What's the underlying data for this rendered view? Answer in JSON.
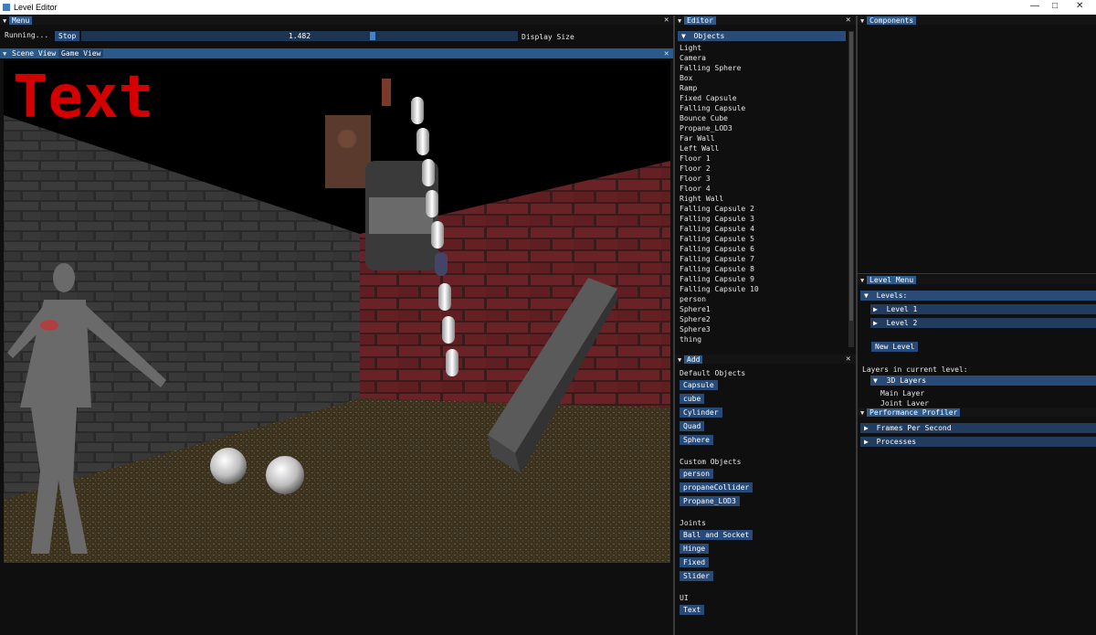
{
  "window": {
    "title": "Level Editor",
    "controls": [
      "—",
      "□",
      "✕"
    ]
  },
  "menu_panel": {
    "tab": "Menu",
    "status": "Running...",
    "stop_label": "Stop",
    "display_size_value": "1.482",
    "display_size_label": "Display Size",
    "slider_fraction": 0.67
  },
  "viewport": {
    "tabs": [
      "Scene View",
      "Game View"
    ],
    "overlay_text": "Text",
    "text_color": "#d40000"
  },
  "editor": {
    "tab": "Editor",
    "header": "Objects",
    "objects": [
      "Light",
      "Camera",
      "Falling Sphere",
      "Box",
      "Ramp",
      "Fixed Capsule",
      "Falling Capsule",
      "Bounce Cube",
      "Propane_LOD3",
      "Far Wall",
      "Left Wall",
      "Floor 1",
      "Floor 2",
      "Floor 3",
      "Floor 4",
      "Right Wall",
      "Falling Capsule 2",
      "Falling Capsule 3",
      "Falling Capsule 4",
      "Falling Capsule 5",
      "Falling Capsule 6",
      "Falling Capsule 7",
      "Falling Capsule 8",
      "Falling Capsule 9",
      "Falling Capsule 10",
      "person",
      "Sphere1",
      "Sphere2",
      "Sphere3",
      "thing"
    ]
  },
  "add_panel": {
    "tab": "Add",
    "default_label": "Default Objects",
    "default_buttons": [
      "Capsule",
      "cube",
      "Cylinder",
      "Quad",
      "Sphere"
    ],
    "custom_label": "Custom Objects",
    "custom_buttons": [
      "person",
      "propaneCollider",
      "Propane_LOD3"
    ],
    "joints_label": "Joints",
    "joint_buttons": [
      "Ball and Socket",
      "Hinge",
      "Fixed",
      "Slider"
    ],
    "ui_label": "UI",
    "ui_buttons": [
      "Text"
    ]
  },
  "components": {
    "tab": "Components"
  },
  "level_menu": {
    "tab": "Level Menu",
    "levels_header": "Levels:",
    "levels": [
      "Level 1",
      "Level 2"
    ],
    "new_level": "New Level",
    "layers_label": "Layers in current level:",
    "layers_header": "3D Layers",
    "layers": [
      "Main Layer",
      "Joint Layer"
    ]
  },
  "profiler": {
    "tab": "Performance Profiler",
    "items": [
      "Frames Per Second",
      "Processes"
    ]
  },
  "colors": {
    "accent": "#2e5a8c",
    "button": "#274a78",
    "background": "#0f0f0f"
  }
}
